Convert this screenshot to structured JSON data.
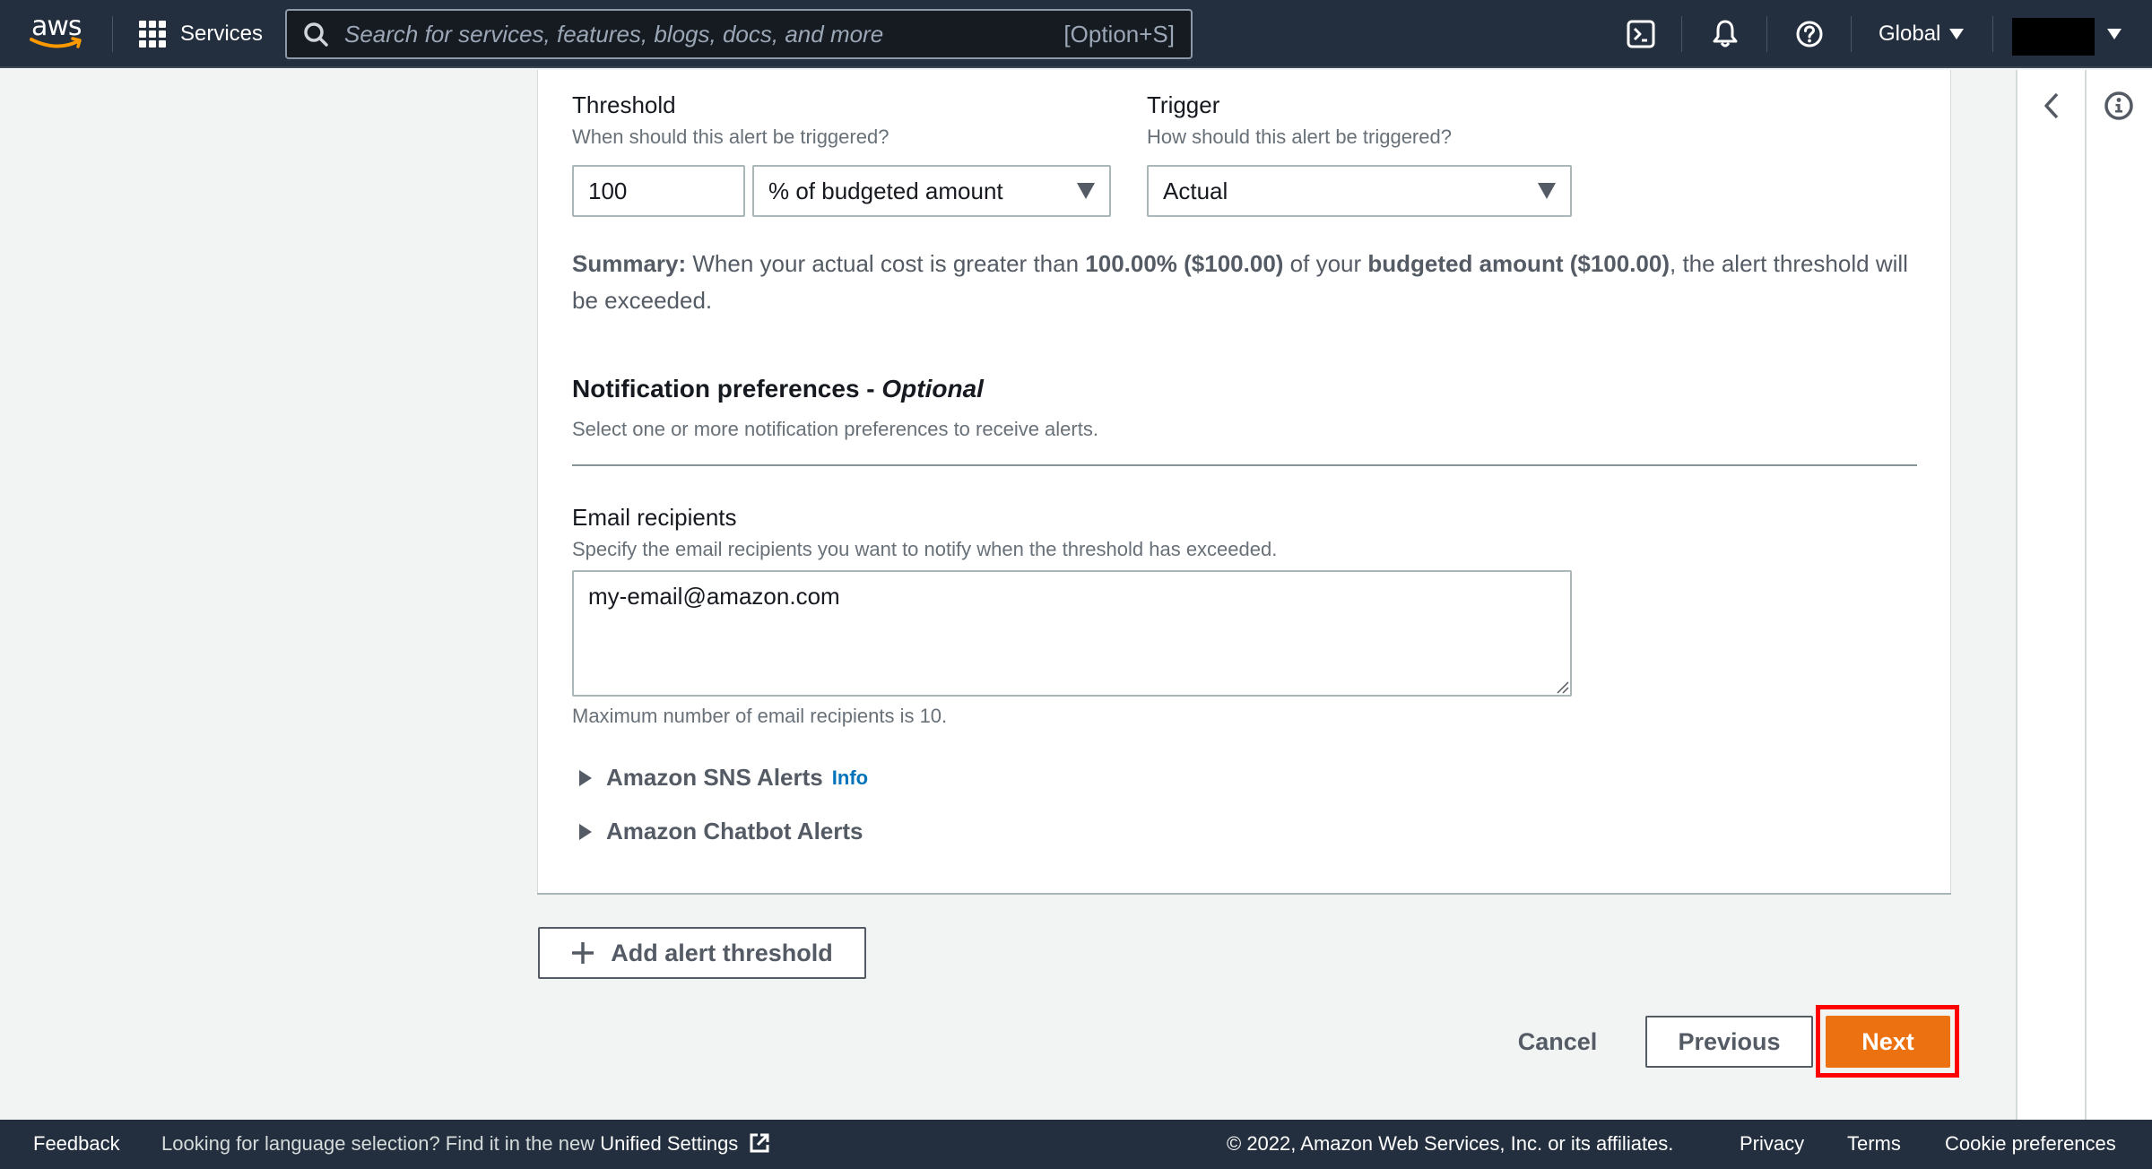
{
  "header": {
    "logo_text": "aws",
    "services_label": "Services",
    "search_placeholder": "Search for services, features, blogs, docs, and more",
    "search_shortcut": "[Option+S]",
    "region_label": "Global",
    "icons": [
      "cloudshell-icon",
      "notifications-bell-icon",
      "help-icon"
    ]
  },
  "side_panel": {
    "icons": [
      "collapse-chevron-left-icon",
      "info-icon"
    ]
  },
  "threshold": {
    "label": "Threshold",
    "hint": "When should this alert be triggered?",
    "value": "100",
    "unit_selected": "% of budgeted amount"
  },
  "trigger": {
    "label": "Trigger",
    "hint": "How should this alert be triggered?",
    "selected": "Actual"
  },
  "summary": {
    "label": "Summary:",
    "part1": " When your actual cost is greater than ",
    "bold1": "100.00% ($100.00)",
    "part2": " of your ",
    "bold2": "budgeted amount ($100.00)",
    "part3": ", the alert threshold will be exceeded."
  },
  "notifications": {
    "heading": "Notification preferences - ",
    "heading_optional": "Optional",
    "description": "Select one or more notification preferences to receive alerts.",
    "email_label": "Email recipients",
    "email_hint": "Specify the email recipients you want to notify when the threshold has exceeded.",
    "email_value": "my-email@amazon.com",
    "email_constraint": "Maximum number of email recipients is 10.",
    "sns_label": "Amazon SNS Alerts",
    "sns_info": "Info",
    "chatbot_label": "Amazon Chatbot Alerts"
  },
  "actions": {
    "add_threshold": "Add alert threshold",
    "cancel": "Cancel",
    "previous": "Previous",
    "next": "Next"
  },
  "footer": {
    "feedback": "Feedback",
    "language_note": "Looking for language selection? Find it in the new ",
    "unified_settings": "Unified Settings",
    "copyright": "© 2022, Amazon Web Services, Inc. or its affiliates.",
    "privacy": "Privacy",
    "terms": "Terms",
    "cookie": "Cookie preferences"
  },
  "colors": {
    "header_bg": "#232f3e",
    "primary_button": "#ec7211",
    "link": "#0073bb",
    "highlight": "#ff0000"
  }
}
